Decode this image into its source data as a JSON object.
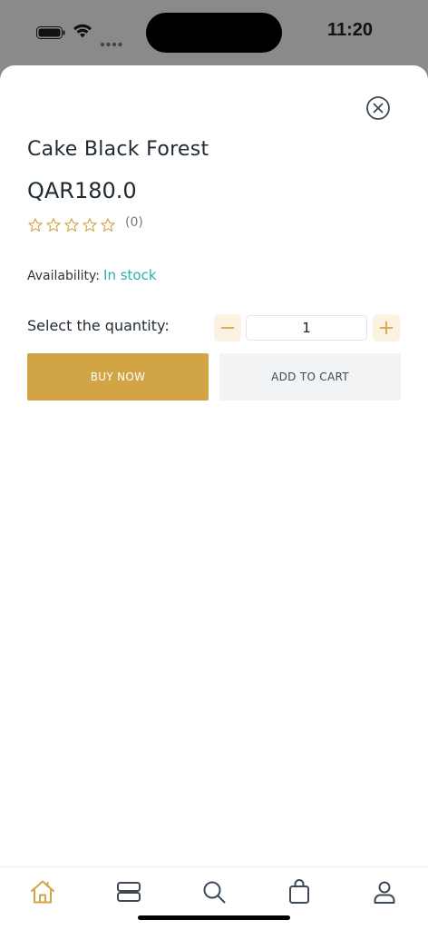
{
  "status_bar": {
    "time": "11:20"
  },
  "product": {
    "title": "Cake Black Forest",
    "price": "QAR180.0",
    "rating": {
      "stars_filled": 0,
      "stars_total": 5,
      "count_label": "(0)"
    },
    "availability_label": "Availability:",
    "availability_value": "In stock"
  },
  "quantity": {
    "label": "Select the quantity:",
    "value": "1"
  },
  "actions": {
    "buy_now": "BUY NOW",
    "add_to_cart": "ADD TO CART"
  },
  "colors": {
    "accent": "#d1a446",
    "in_stock": "#27b0a8",
    "text_dark": "#1f2a33"
  },
  "icons": {
    "close": "close-circle-icon",
    "star": "star-outline-icon",
    "minus": "minus-icon",
    "plus": "plus-icon",
    "home": "home-icon",
    "categories": "categories-icon",
    "search": "search-icon",
    "cart": "shopping-bag-icon",
    "account": "user-icon"
  },
  "bottom_nav": {
    "active": "home"
  }
}
